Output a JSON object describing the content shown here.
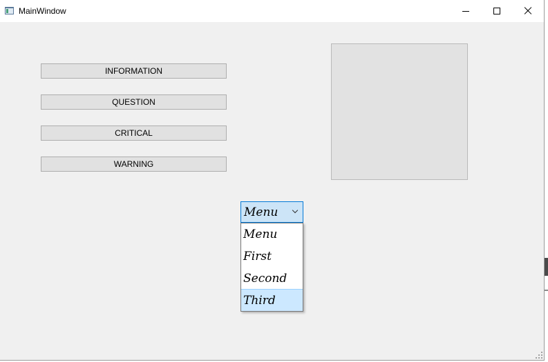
{
  "window": {
    "title": "MainWindow",
    "icon": "app-window-icon"
  },
  "caption_buttons": {
    "minimize_icon": "minimize-icon",
    "maximize_icon": "maximize-icon",
    "close_icon": "close-icon"
  },
  "buttons": {
    "information": "INFORMATION",
    "question": "QUESTION",
    "critical": "CRITICAL",
    "warning": "WARNING"
  },
  "combo": {
    "selected": "Menu",
    "options": [
      "Menu",
      "First",
      "Second",
      "Third"
    ],
    "highlighted_option": "Third",
    "highlight_color": "#cce8ff",
    "focus_border_color": "#0078d7"
  },
  "image_box": {
    "background_color": "#e2e2e2"
  }
}
